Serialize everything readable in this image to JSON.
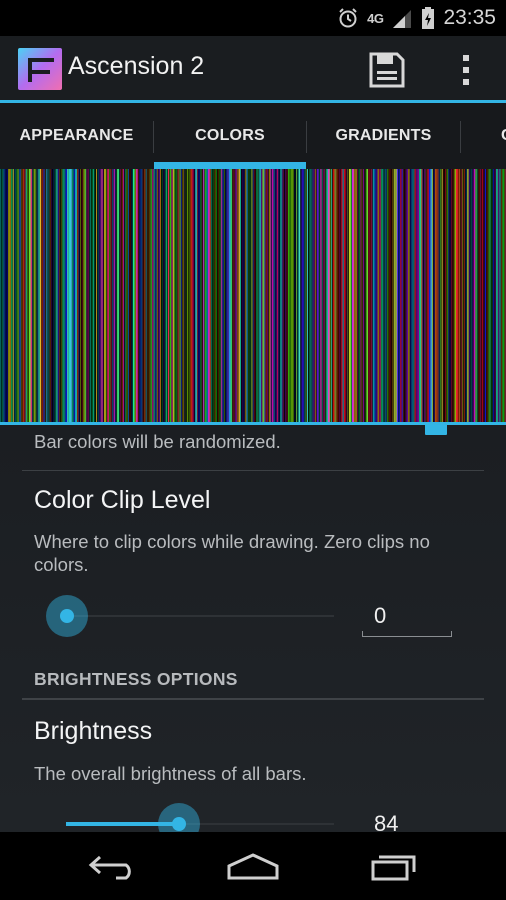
{
  "status_bar": {
    "network": "4G",
    "time": "23:35"
  },
  "app": {
    "title": "Ascension 2"
  },
  "tabs": [
    {
      "label": "APPEARANCE",
      "selected": false
    },
    {
      "label": "COLORS",
      "selected": true
    },
    {
      "label": "GRADIENTS",
      "selected": false
    },
    {
      "label": "C",
      "selected": false
    }
  ],
  "settings": {
    "random_colors_summary": "Bar colors will be randomized.",
    "color_clip": {
      "title": "Color Clip Level",
      "summary": "Where to clip colors while drawing. Zero clips no colors.",
      "value": "0"
    },
    "brightness_category": "BRIGHTNESS OPTIONS",
    "brightness": {
      "title": "Brightness",
      "summary": "The overall brightness of all bars.",
      "value": "84"
    }
  },
  "colors": {
    "accent": "#33b5e5",
    "background": "#1b1e22"
  },
  "icons": [
    "alarm-icon",
    "signal-icon",
    "battery-icon",
    "app-logo-icon",
    "save-icon",
    "overflow-menu-icon",
    "back-icon",
    "home-icon",
    "recents-icon"
  ]
}
